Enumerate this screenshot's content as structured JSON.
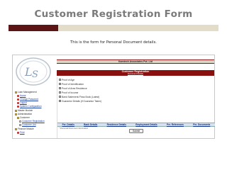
{
  "slide": {
    "title": "Customer Registration Form",
    "subtitle": "This is the form for Personal Document details."
  },
  "app": {
    "company": "Kamtech Associates Pvt. Ltd",
    "header_title": "Customer Registration",
    "header_sub": "Document Details"
  },
  "sidebar": {
    "items": [
      {
        "label": "Loan Management",
        "icon": "folder-icon"
      },
      {
        "label": "Home",
        "icon": "red-dot-icon"
      },
      {
        "label": "Change Password",
        "icon": "red-dot-icon"
      },
      {
        "label": "Logout",
        "icon": "red-dot-icon"
      },
      {
        "label": "System Configuration",
        "icon": "red-dot-icon"
      },
      {
        "label": "Master Module",
        "icon": "folder-icon"
      },
      {
        "label": "Administration",
        "icon": "folder-icon"
      },
      {
        "label": "Customer",
        "icon": "folder-icon"
      },
      {
        "label": "Customer Registration",
        "icon": "doc-icon"
      },
      {
        "label": "Customer List",
        "icon": "doc-icon"
      },
      {
        "label": "Finance Module",
        "icon": "folder-icon"
      },
      {
        "label": "Print",
        "icon": "red-dot-icon"
      }
    ]
  },
  "documents": [
    "Proof of Age",
    "Proof of Identification",
    "Proof of Area Residence",
    "Proof of Income",
    "Bank Statement/ Pass Book (Latest)",
    "Guarantor Details (if Guarantor Taken)"
  ],
  "tabs": [
    "Per. Details",
    "Bank Details",
    "Residence Details",
    "Employment Details",
    "Per. References",
    "Per. Documents"
  ],
  "note": "* Personal Document Information",
  "submit_label": "Submit"
}
